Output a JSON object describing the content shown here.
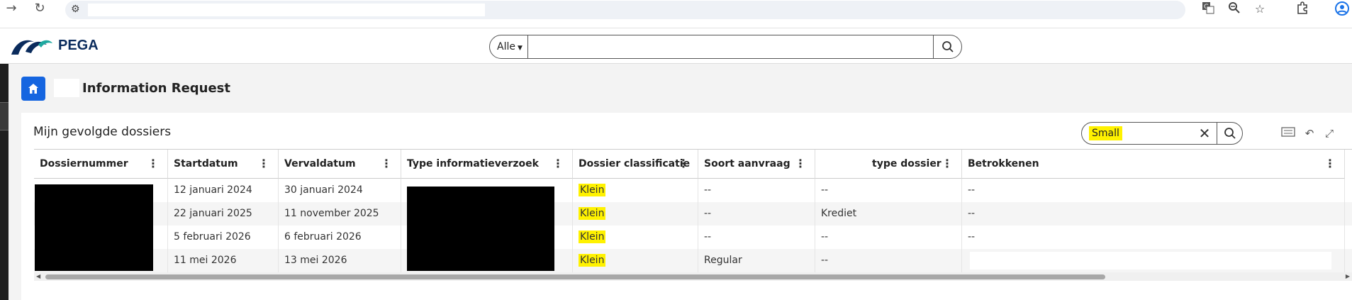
{
  "browser": {
    "back_icon": "arrow-right-icon",
    "reload_icon": "reload-icon",
    "icons": [
      "translate-icon",
      "zoom-icon",
      "star-icon",
      "extensions-icon",
      "profile-icon"
    ]
  },
  "header": {
    "logo_text": "PEGA",
    "search_scope": "Alle",
    "search_placeholder": ""
  },
  "page": {
    "title": "Information Request"
  },
  "card": {
    "title": "Mijn gevolgde dossiers",
    "filter_value": "Small",
    "columns": [
      "Dossiernummer",
      "Startdatum",
      "Vervaldatum",
      "Type informatieverzoek",
      "Dossier classificatie",
      "Soort aanvraag",
      "type dossier",
      "Betrokkenen"
    ],
    "rows": [
      {
        "start": "12 januari 2024",
        "end": "30 januari 2024",
        "class": "Klein",
        "soort": "--",
        "type": "--",
        "betr": "--"
      },
      {
        "start": "22 januari 2025",
        "end": "11 november 2025",
        "class": "Klein",
        "soort": "--",
        "type": "Krediet",
        "betr": "--"
      },
      {
        "start": "5 februari 2026",
        "end": "6 februari 2026",
        "class": "Klein",
        "soort": "--",
        "type": "--",
        "betr": "--"
      },
      {
        "start": "11 mei 2026",
        "end": "13 mei 2026",
        "class": "Klein",
        "soort": "Regular",
        "type": "--",
        "betr": ""
      }
    ]
  },
  "colors": {
    "accent": "#1565e0",
    "highlight": "#fff200",
    "logo": "#0a2b5c"
  }
}
